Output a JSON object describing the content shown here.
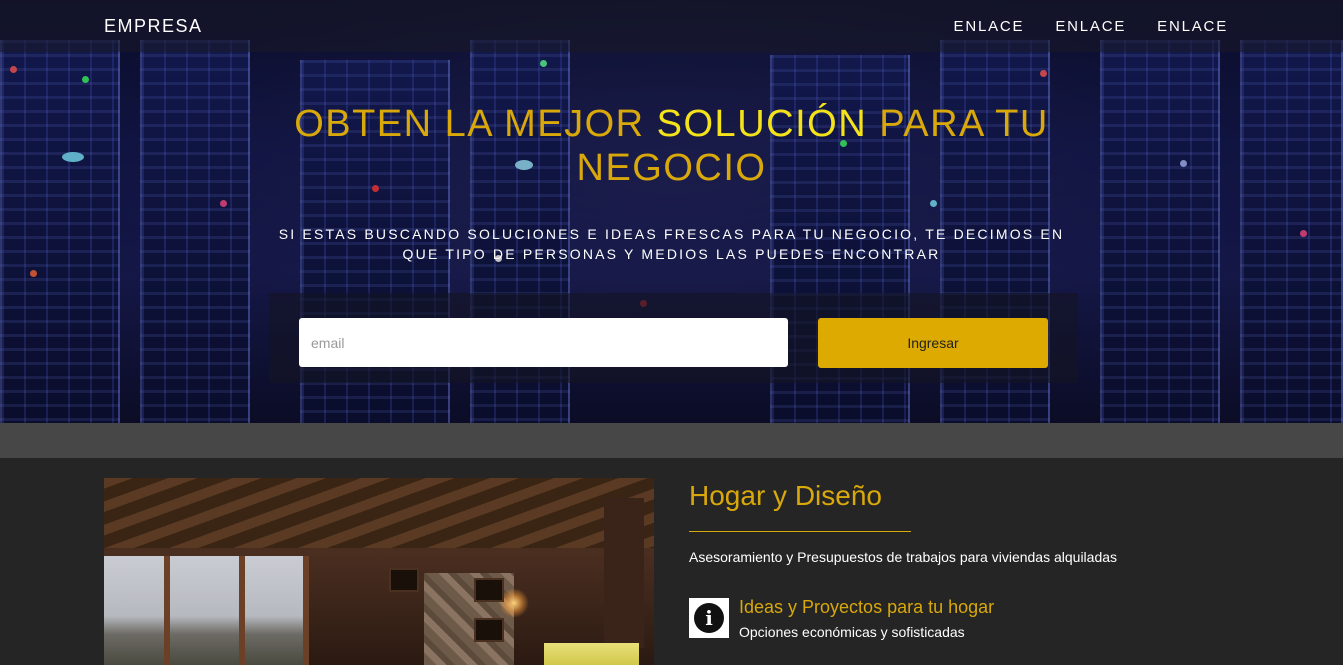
{
  "navbar": {
    "brand": "EMPRESA",
    "links": [
      "ENLACE",
      "ENLACE",
      "ENLACE"
    ]
  },
  "hero": {
    "title_part1": "OBTEN LA MEJOR ",
    "title_highlight": "SOLUCIÓN",
    "title_part2": " PARA TU NEGOCIO",
    "subtitle": "SI ESTAS BUSCANDO SOLUCIONES E IDEAS FRESCAS PARA TU NEGOCIO, TE DECIMOS EN QUE TIPO DE PERSONAS Y MEDIOS LAS PUEDES ENCONTRAR",
    "email_placeholder": "email",
    "submit_label": "Ingresar"
  },
  "feature": {
    "title": "Hogar y Diseño",
    "description": "Asesoramiento y Presupuestos de trabajos para viviendas alquiladas",
    "item_icon": "info-icon",
    "item_title": "Ideas y Proyectos para tu hogar",
    "item_description": "Opciones económicas y sofisticadas"
  },
  "colors": {
    "accent_gold": "#d9a80a",
    "highlight_yellow": "#f4e21a",
    "button_gold": "#dcaa00",
    "section_bg": "#252525",
    "band_bg": "#474747"
  }
}
